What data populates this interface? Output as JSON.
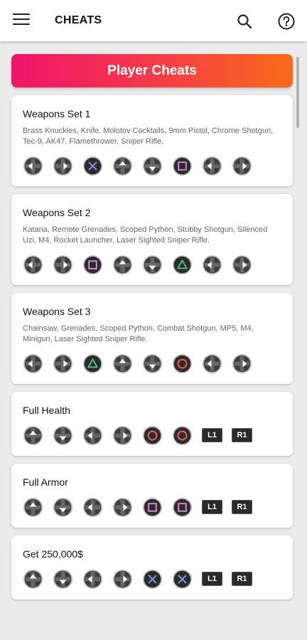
{
  "app_bar": {
    "title": "CHEATS",
    "menu_icon": "hamburger-menu-icon",
    "search_icon": "search-icon",
    "help_icon": "help-circle-icon"
  },
  "section_banner": {
    "label": "Player Cheats",
    "gradient": [
      "#f0146a",
      "#f96a1a"
    ]
  },
  "cheats": [
    {
      "name": "Weapons Set 1",
      "description": "Brass Knuckles, Knife, Molotov Cocktails, 9mm Pistol, Chrome Shotgun, Tec-9, AK47, Flamethrower, Sniper Rifle.",
      "buttons": [
        "left",
        "right",
        "cross",
        "up",
        "down",
        "square",
        "left",
        "right"
      ]
    },
    {
      "name": "Weapons Set 2",
      "description": "Katana, Remote Grenades, Scoped Python, Stubby Shotgun, Silenced Uzi, M4, Rocket Launcher, Laser Sighted Sniper Rifle.",
      "buttons": [
        "left",
        "right",
        "square",
        "up",
        "down",
        "triangle",
        "left",
        "right"
      ]
    },
    {
      "name": "Weapons Set 3",
      "description": "Chainsaw, Grenades, Scoped Python, Combat Shotgun, MP5, M4, Minigun, Laser Sighted Sniper Rifle.",
      "buttons": [
        "left",
        "right",
        "triangle",
        "up",
        "down",
        "circle",
        "left",
        "right"
      ]
    },
    {
      "name": "Full Health",
      "description": "",
      "buttons": [
        "up",
        "down",
        "left",
        "right",
        "circle",
        "circle",
        "L1",
        "R1"
      ]
    },
    {
      "name": "Full Armor",
      "description": "",
      "buttons": [
        "up",
        "down",
        "left",
        "right",
        "square",
        "square",
        "L1",
        "R1"
      ]
    },
    {
      "name": "Get 250,000$",
      "description": "",
      "buttons": [
        "up",
        "down",
        "left",
        "right",
        "cross",
        "cross",
        "L1",
        "R1"
      ]
    }
  ],
  "button_colors": {
    "dpad": "#3d3d3d",
    "cross": "#7e8fd6",
    "square": "#d58ad0",
    "triangle": "#4fc07a",
    "circle": "#e85a5a",
    "face_bg": "#2b2b2b"
  }
}
